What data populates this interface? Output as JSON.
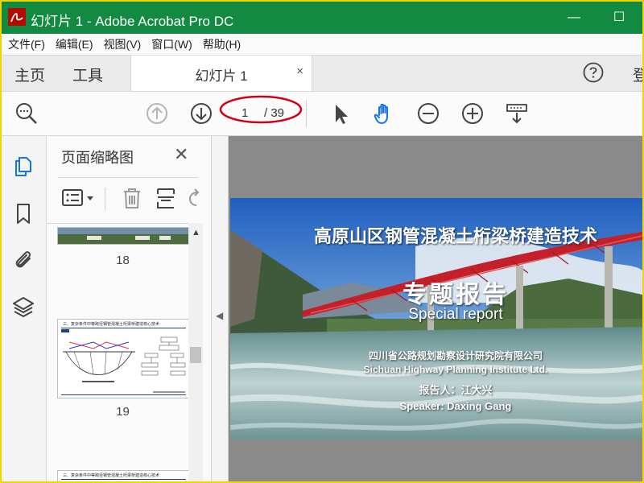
{
  "colors": {
    "titlebar": "#128a41",
    "frame_border": "#f2d400",
    "accent_blue": "#1473e6",
    "annotation_red": "#d0021b"
  },
  "window": {
    "title": "幻灯片 1 - Adobe Acrobat Pro DC"
  },
  "menu": [
    "文件(F)",
    "编辑(E)",
    "视图(V)",
    "窗口(W)",
    "帮助(H)"
  ],
  "tabs": {
    "home": "主页",
    "tools": "工具",
    "document": "幻灯片 1",
    "close_glyph": "×",
    "signin_partial": "登"
  },
  "toolbar": {
    "page_current": "1",
    "page_total": "/ 39",
    "icons": [
      "magnify-comment-icon",
      "prev-page-icon",
      "next-page-icon",
      "select-arrow-icon",
      "hand-icon",
      "zoom-out-icon",
      "zoom-in-icon",
      "keyboard-tool-icon"
    ]
  },
  "left_rail": {
    "icons": [
      "pages-icon",
      "bookmark-icon",
      "attachment-icon",
      "layers-icon"
    ]
  },
  "thumbnail_panel": {
    "title": "页面缩略图",
    "close_glyph": "✕",
    "thumbnails": [
      {
        "page": "18"
      },
      {
        "page": "19",
        "heading": "三、复杂条件中等跨径钢管混凝土桁梁桥建造核心技术"
      },
      {
        "heading": "三、复杂条件中等跨径钢管混凝土桁梁桥建造核心技术"
      }
    ]
  },
  "slide": {
    "title": "高原山区钢管混凝土桁梁桥建造技术",
    "subtitle": "专题报告",
    "subtitle_en": "Special report",
    "org": "四川省公路规划勘察设计研究院有限公司",
    "org_en": "Sichuan Highway Planning Institute Ltd.",
    "speaker": "报告人：江大兴",
    "speaker_en": "Speaker: Daxing Gang"
  }
}
